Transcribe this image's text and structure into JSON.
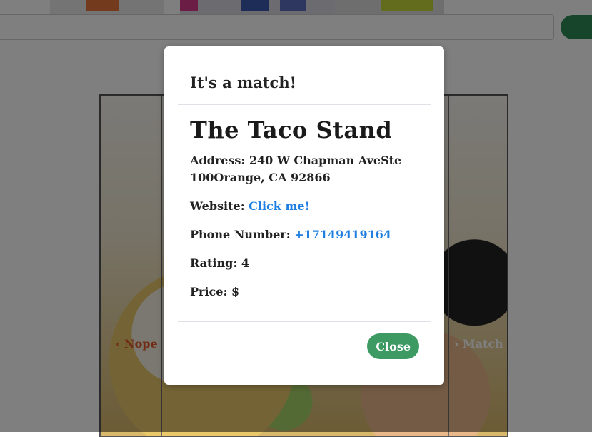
{
  "background": {
    "search": {
      "placeholder": ""
    },
    "swipe": {
      "nope_label": "Nope",
      "match_label": "Match"
    }
  },
  "modal": {
    "title": "It's a match!",
    "business_name": "The Taco Stand",
    "address_label": "Address:",
    "address_value": "240 W Chapman AveSte 100Orange, CA 92866",
    "website_label": "Website:",
    "website_link": "Click me!",
    "phone_label": "Phone Number:",
    "phone_value": "+17149419164",
    "rating_label": "Rating:",
    "rating_value": "4",
    "price_label": "Price:",
    "price_value": "$",
    "close_label": "Close"
  },
  "colors": {
    "accent_green": "#3d9a63",
    "link_blue": "#1e7fe0",
    "nope_orange": "#e05a2a"
  }
}
